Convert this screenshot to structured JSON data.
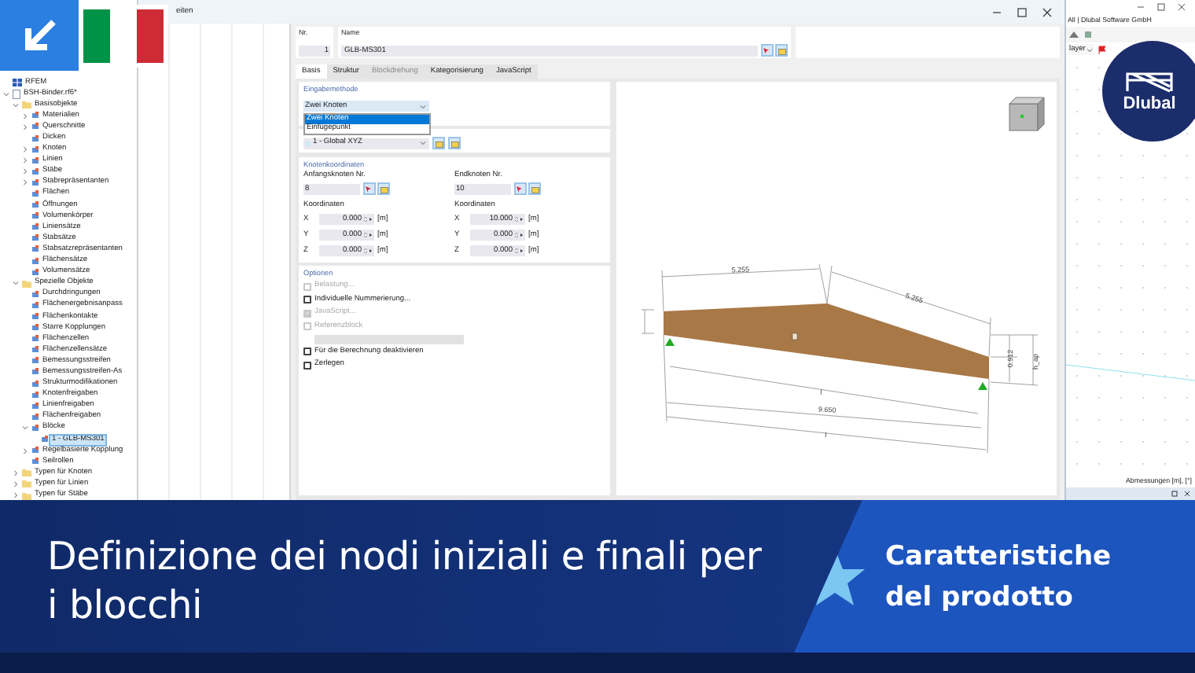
{
  "overlay": {
    "logo_text": "Dlubal"
  },
  "tree": [
    {
      "label": "RFEM",
      "kind": "app",
      "selected": false
    },
    {
      "label": "BSH-Binder.rf6*",
      "kind": "model",
      "selected": false,
      "expanded": true,
      "children": [
        {
          "label": "Basisobjekte",
          "kind": "folder",
          "selected": false,
          "expanded": true,
          "children": [
            {
              "label": "Materialien",
              "selected": false,
              "expanded": false
            },
            {
              "label": "Querschnitte",
              "selected": false,
              "expanded": false
            },
            {
              "label": "Dicken",
              "selected": false
            },
            {
              "label": "Knoten",
              "selected": false,
              "expanded": false
            },
            {
              "label": "Linien",
              "selected": false,
              "expanded": false
            },
            {
              "label": "Stäbe",
              "selected": false,
              "expanded": false
            },
            {
              "label": "Stabrepräsentanten",
              "selected": false,
              "expanded": false
            },
            {
              "label": "Flächen",
              "selected": false
            },
            {
              "label": "Öffnungen",
              "selected": false
            },
            {
              "label": "Volumenkörper",
              "selected": false
            },
            {
              "label": "Liniensätze",
              "selected": false
            },
            {
              "label": "Stabsätze",
              "selected": false
            },
            {
              "label": "Stabsatzrepräsentanten",
              "selected": false
            },
            {
              "label": "Flächensätze",
              "selected": false
            },
            {
              "label": "Volumensätze",
              "selected": false
            }
          ]
        },
        {
          "label": "Spezielle Objekte",
          "kind": "folder",
          "selected": false,
          "expanded": true,
          "children": [
            {
              "label": "Durchdringungen",
              "selected": false
            },
            {
              "label": "Flächenergebnisanpass",
              "selected": false
            },
            {
              "label": "Flächenkontakte",
              "selected": false
            },
            {
              "label": "Starre Kopplungen",
              "selected": false
            },
            {
              "label": "Flächenzellen",
              "selected": false
            },
            {
              "label": "Flächenzellensätze",
              "selected": false
            },
            {
              "label": "Bemessungsstreifen",
              "selected": false
            },
            {
              "label": "Bemessungsstreifen-As",
              "selected": false
            },
            {
              "label": "Strukturmodifikationen",
              "selected": false
            },
            {
              "label": "Knotenfreigaben",
              "selected": false
            },
            {
              "label": "Linienfreigaben",
              "selected": false
            },
            {
              "label": "Flächenfreigaben",
              "selected": false
            },
            {
              "label": "Blöcke",
              "selected": false,
              "expanded": true,
              "children": [
                {
                  "label": "1 - GLB-MS301",
                  "selected": true
                }
              ]
            },
            {
              "label": "Regelbasierte Kopplung",
              "selected": false,
              "expanded": false
            },
            {
              "label": "Seilrollen",
              "selected": false
            }
          ]
        },
        {
          "label": "Typen für Knoten",
          "kind": "folder",
          "selected": false,
          "expanded": false
        },
        {
          "label": "Typen für Linien",
          "kind": "folder",
          "selected": false,
          "expanded": false
        },
        {
          "label": "Typen für Stäbe",
          "kind": "folder",
          "selected": false,
          "expanded": false
        }
      ]
    }
  ],
  "dialog": {
    "title": "eiten",
    "number": {
      "label": "Nr.",
      "value": "1"
    },
    "name": {
      "label": "Name",
      "value": "GLB-MS301"
    },
    "tabs": [
      {
        "label": "Basis",
        "selected": true,
        "disabled": false
      },
      {
        "label": "Struktur",
        "selected": false,
        "disabled": false
      },
      {
        "label": "Blockdrehung",
        "selected": false,
        "disabled": true
      },
      {
        "label": "Kategorisierung",
        "selected": false,
        "disabled": false
      },
      {
        "label": "JavaScript",
        "selected": false,
        "disabled": false
      }
    ],
    "input_method": {
      "title": "Eingabemethode",
      "value": "Zwei Knoten",
      "options": [
        {
          "label": "Zwei Knoten",
          "selected": true
        },
        {
          "label": "Einfügepunkt",
          "selected": false
        }
      ]
    },
    "coordinate_system": {
      "value": "1 - Global XYZ"
    },
    "node_coordinates": {
      "title": "Knotenkoordinaten",
      "nodes": [
        {
          "label": "Anfangsknoten Nr.",
          "value": "8",
          "coords_label": "Koordinaten",
          "coords": [
            {
              "axis": "X",
              "value": "0.000",
              "unit": "[m]"
            },
            {
              "axis": "Y",
              "value": "0.000",
              "unit": "[m]"
            },
            {
              "axis": "Z",
              "value": "0.000",
              "unit": "[m]"
            }
          ]
        },
        {
          "label": "Endknoten Nr.",
          "value": "10",
          "coords_label": "Koordinaten",
          "coords": [
            {
              "axis": "X",
              "value": "10.000",
              "unit": "[m]"
            },
            {
              "axis": "Y",
              "value": "0.000",
              "unit": "[m]"
            },
            {
              "axis": "Z",
              "value": "0.000",
              "unit": "[m]"
            }
          ]
        }
      ]
    },
    "options": {
      "title": "Optionen",
      "items": [
        {
          "kind": "checkbox",
          "label": "Belastung...",
          "checked": false,
          "disabled": true
        },
        {
          "kind": "checkbox",
          "label": "Individuelle Nummerierung...",
          "checked": false,
          "disabled": false
        },
        {
          "kind": "checkbox",
          "label": "JavaScript...",
          "checked": true,
          "disabled": true
        },
        {
          "kind": "checkbox",
          "label": "Referenzblock",
          "checked": false,
          "disabled": true
        },
        {
          "kind": "field",
          "disabled": true
        },
        {
          "kind": "checkbox",
          "label": "Für die Berechnung deaktivieren",
          "checked": false,
          "disabled": false
        },
        {
          "kind": "checkbox",
          "label": "Zerlegen",
          "checked": false,
          "disabled": false
        }
      ]
    },
    "drawing": {
      "labels": [
        "5.255",
        "5.255",
        "9.650",
        "0.912",
        "h_ap",
        "l",
        "l"
      ]
    }
  },
  "app": {
    "title": "All | Dlubal Software GmbH",
    "layer": "layer",
    "status": "Abmessungen [m], [°]"
  },
  "banner": {
    "title": "Definizione dei nodi iniziali e finali per i blocchi",
    "badge": "Caratteristiche del prodotto"
  }
}
